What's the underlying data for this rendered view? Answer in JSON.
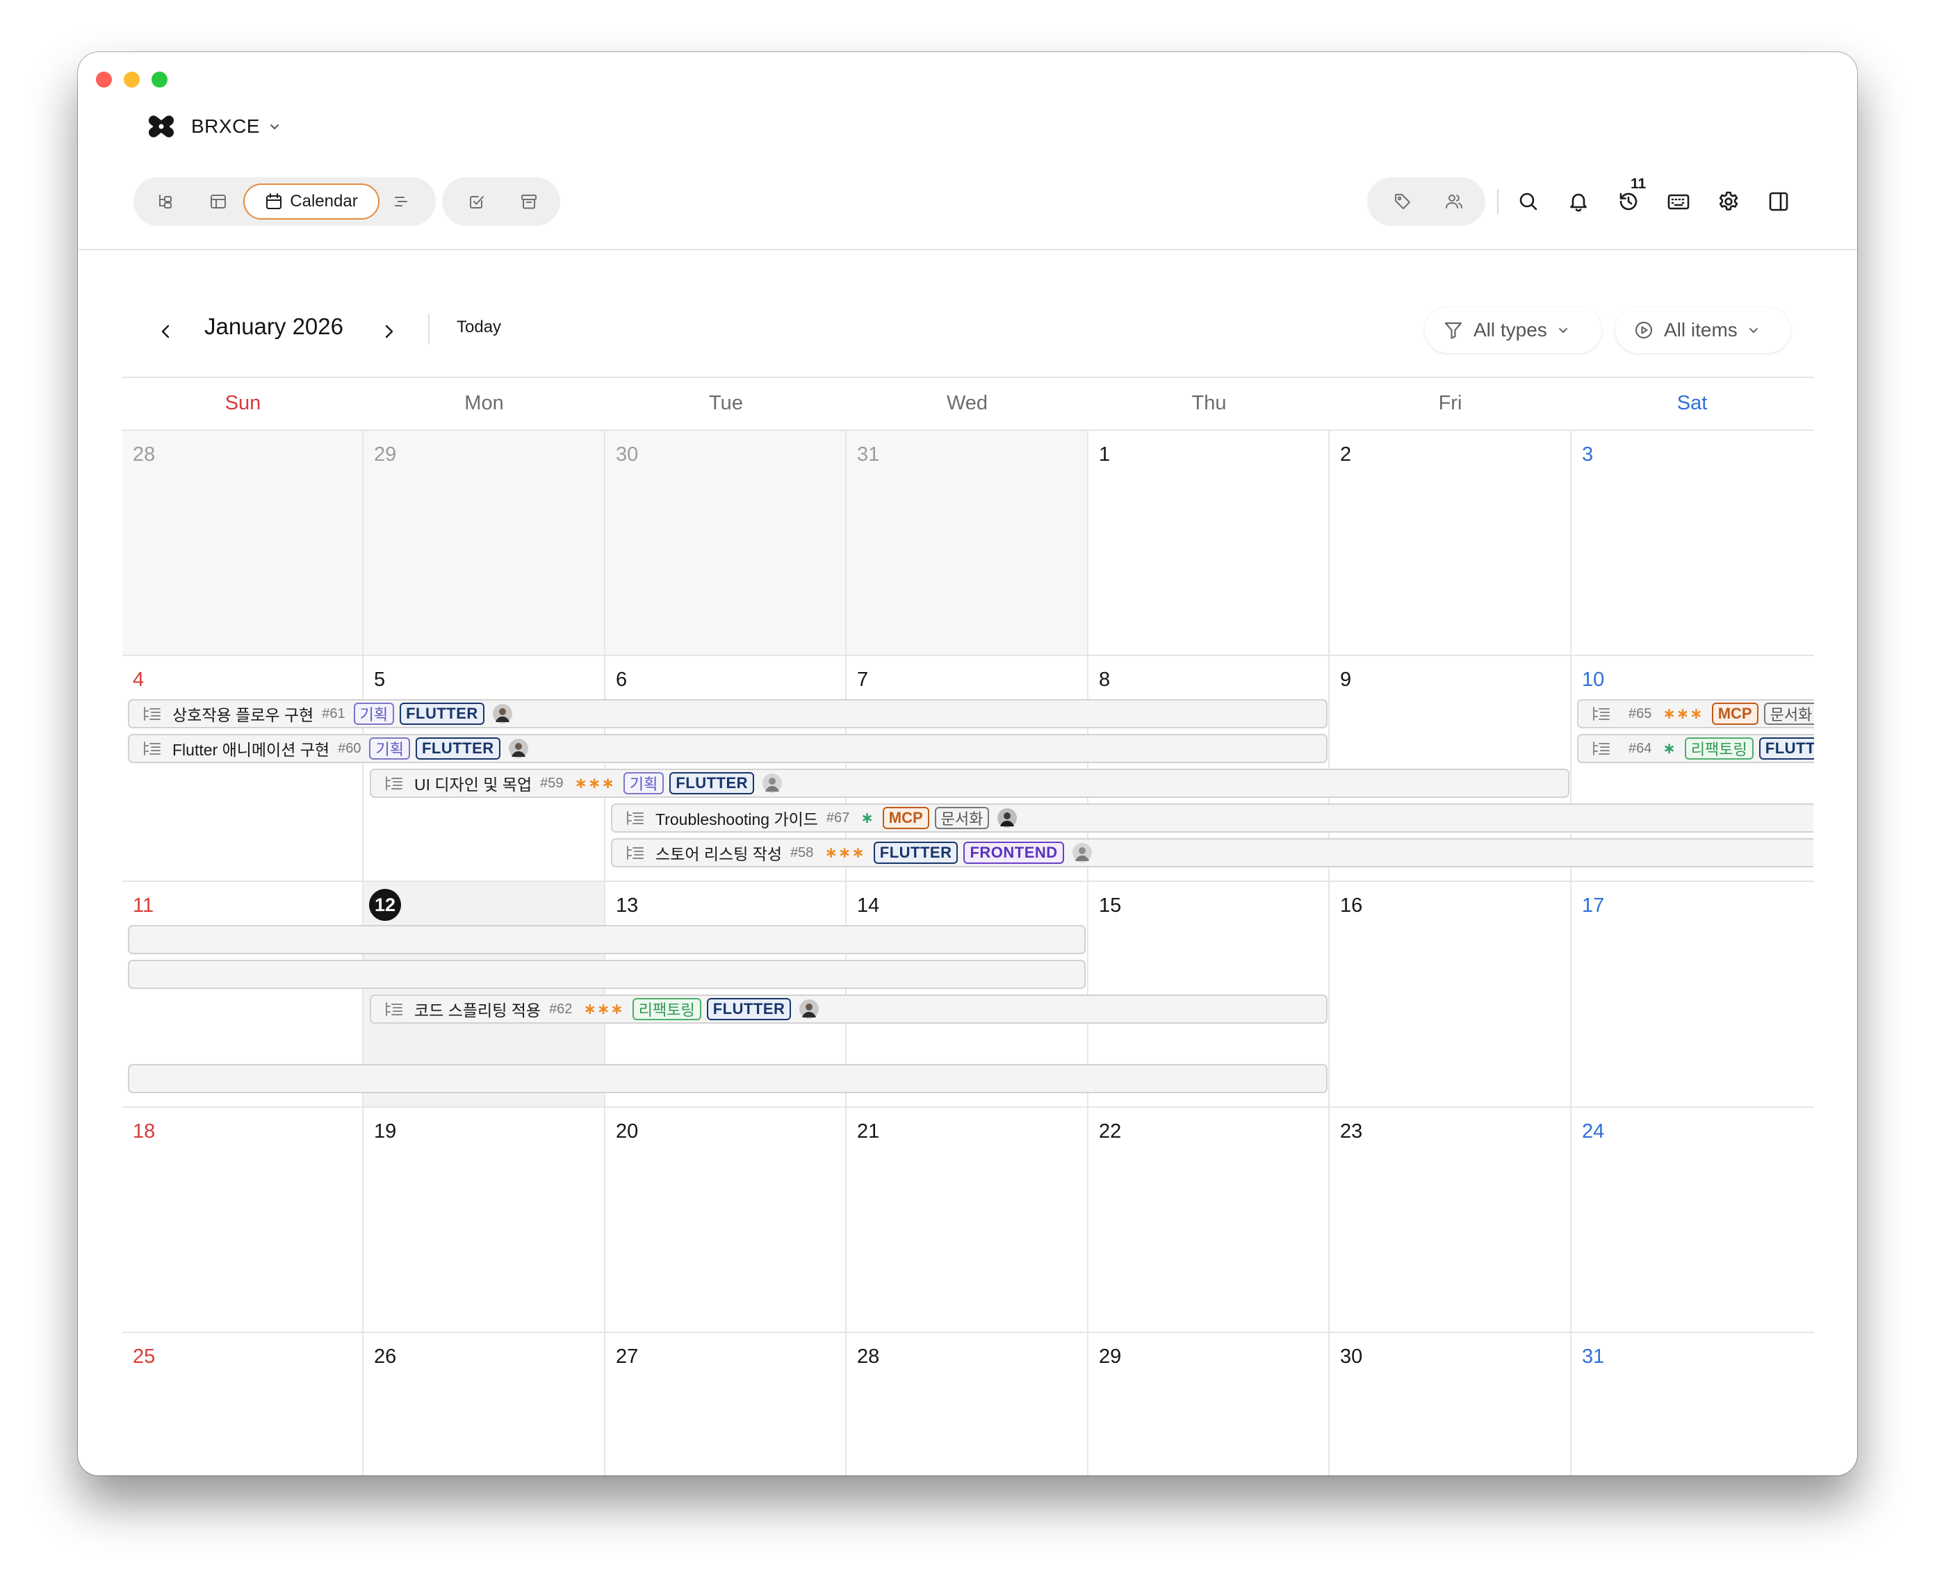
{
  "app": {
    "name": "BRXCE",
    "brand_color": "#161616"
  },
  "toolbar": {
    "views": [
      {
        "name": "hierarchy-view-icon"
      },
      {
        "name": "table-view-icon"
      },
      {
        "name": "calendar-view",
        "label": "Calendar",
        "active": true
      },
      {
        "name": "timeline-view-icon"
      }
    ],
    "secondary": [
      {
        "name": "checkbox-icon"
      },
      {
        "name": "archive-icon"
      }
    ],
    "right_tools": [
      "tag-icon",
      "people-icon",
      "search-icon",
      "bell-icon",
      "history-icon",
      "keyboard-icon",
      "gear-icon",
      "sidebar-toggle-icon"
    ],
    "history_badge": "11",
    "accent": "#e38b3d"
  },
  "calendar": {
    "month_label": "January 2026",
    "today_label": "Today",
    "filters": {
      "types": "All types",
      "items": "All items"
    },
    "weekdays": [
      "Sun",
      "Mon",
      "Tue",
      "Wed",
      "Thu",
      "Fri",
      "Sat"
    ],
    "weeks": [
      [
        "28",
        "29",
        "30",
        "31",
        "1",
        "2",
        "3"
      ],
      [
        "4",
        "5",
        "6",
        "7",
        "8",
        "9",
        "10"
      ],
      [
        "11",
        "12",
        "13",
        "14",
        "15",
        "16",
        "17"
      ],
      [
        "18",
        "19",
        "20",
        "21",
        "22",
        "23",
        "24"
      ],
      [
        "25",
        "26",
        "27",
        "28",
        "29",
        "30",
        "31"
      ]
    ],
    "today": "12",
    "colors": {
      "sunday": "#d83b3b",
      "saturday": "#2f6fd9",
      "priority": "#f08a24"
    }
  },
  "events": [
    {
      "title": "상호작용 플로우 구현",
      "num": "#61",
      "priority": "",
      "tags": [
        "기획",
        "FLUTTER"
      ]
    },
    {
      "title": "Flutter 애니메이션 구현",
      "num": "#60",
      "priority": "",
      "tags": [
        "기획",
        "FLUTTER"
      ]
    },
    {
      "title": "UI 디자인 및 목업",
      "num": "#59",
      "priority": "∗∗∗",
      "tags": [
        "기획",
        "FLUTTER"
      ]
    },
    {
      "title": "Troubleshooting 가이드",
      "num": "#67",
      "priority": "∗",
      "tags": [
        "MCP",
        "문서화"
      ]
    },
    {
      "title": "스토어 리스팅 작성",
      "num": "#58",
      "priority": "∗∗∗",
      "tags": [
        "FLUTTER",
        "FRONTEND"
      ]
    },
    {
      "title": "",
      "num": "#65",
      "priority": "∗∗∗",
      "tags": [
        "MCP",
        "문서화"
      ]
    },
    {
      "title": "",
      "num": "#64",
      "priority": "∗",
      "tags": [
        "리팩토링",
        "FLUTTER"
      ]
    },
    {
      "title": "코드 스플리팅 적용",
      "num": "#62",
      "priority": "∗∗∗",
      "tags": [
        "리팩토링",
        "FLUTTER"
      ]
    }
  ]
}
